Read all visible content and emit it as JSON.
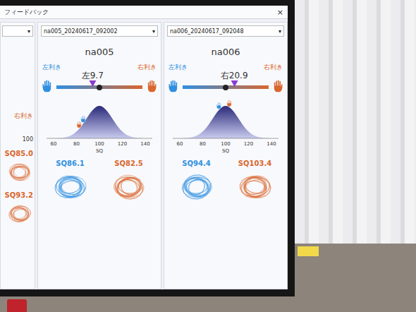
{
  "window": {
    "title": "フィードバック",
    "close": "×"
  },
  "partial_column": {
    "dropdown_arrow": "▾",
    "label": "右利き",
    "axis_tick": "100",
    "scores": [
      {
        "hand": "right",
        "text": "SQ85.0"
      },
      {
        "hand": "right",
        "text": "SQ93.2"
      }
    ]
  },
  "columns": [
    {
      "dropdown": "na005_20240617_092002",
      "dropdown_arrow": "▾",
      "name": "na005",
      "left_label": "左利き",
      "right_label": "右利き",
      "reading": "左9.7",
      "level": 0.42,
      "curve": {
        "ticks": [
          "60",
          "80",
          "100",
          "120",
          "140"
        ],
        "axis_label": "SQ",
        "values": [
          86.1,
          82.5
        ]
      },
      "scores": [
        {
          "hand": "left",
          "text": "SQ86.1"
        },
        {
          "hand": "right",
          "text": "SQ82.5"
        }
      ]
    },
    {
      "dropdown": "na006_20240617_092048",
      "dropdown_arrow": "▾",
      "name": "na006",
      "left_label": "左利き",
      "right_label": "右利き",
      "reading": "右20.9",
      "level": 0.6,
      "curve": {
        "ticks": [
          "60",
          "80",
          "100",
          "120",
          "140"
        ],
        "axis_label": "SQ",
        "values": [
          94.4,
          103.4
        ]
      },
      "scores": [
        {
          "hand": "left",
          "text": "SQ94.4"
        },
        {
          "hand": "right",
          "text": "SQ103.4"
        }
      ]
    }
  ]
}
